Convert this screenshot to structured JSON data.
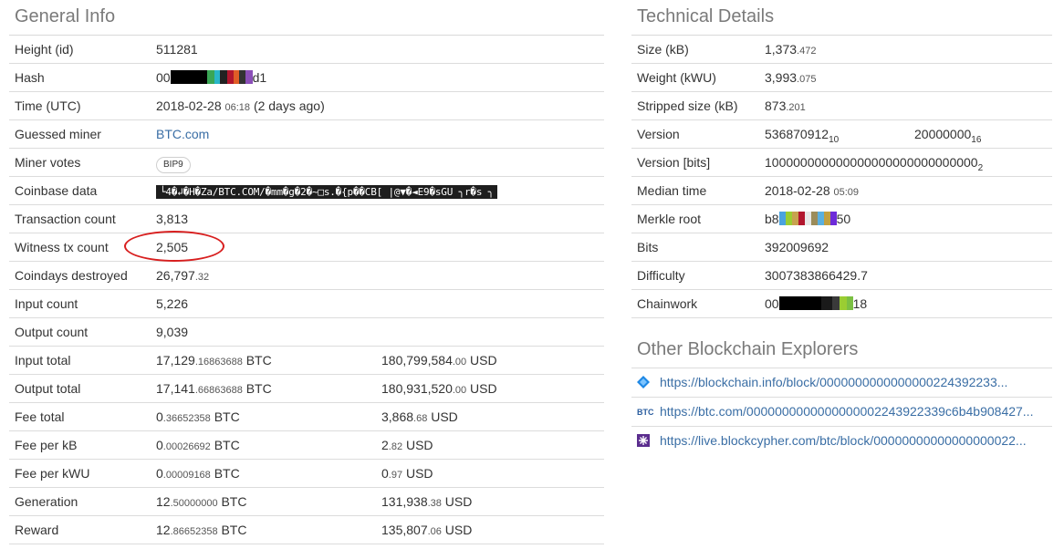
{
  "general": {
    "title": "General Info",
    "height": {
      "label": "Height (id)",
      "value": "511281"
    },
    "hash": {
      "label": "Hash",
      "prefix": "00",
      "suffix": "d1"
    },
    "time": {
      "label": "Time (UTC)",
      "date": "2018-02-28",
      "clock": "06:18",
      "ago": "(2 days ago)"
    },
    "miner": {
      "label": "Guessed miner",
      "value": "BTC.com"
    },
    "votes": {
      "label": "Miner votes",
      "badge": "BIP9"
    },
    "coinbase": {
      "label": "Coinbase data",
      "value": "└4�↲�H�Za/BTC.COM/�mm�g�2�~□s.�{p��CB[ |@▼�◄E9�sGU ╮r�s ╮"
    },
    "tx_count": {
      "label": "Transaction count",
      "value": "3,813"
    },
    "witness": {
      "label": "Witness tx count",
      "value": "2,505"
    },
    "coindays": {
      "label": "Coindays destroyed",
      "main": "26,797",
      "dec": ".32"
    },
    "input_count": {
      "label": "Input count",
      "value": "5,226"
    },
    "output_count": {
      "label": "Output count",
      "value": "9,039"
    },
    "input_total": {
      "label": "Input total",
      "btc_main": "17,129",
      "btc_dec": ".16863688",
      "btc_unit": "BTC",
      "usd_main": "180,799,584",
      "usd_dec": ".00",
      "usd_unit": "USD"
    },
    "output_total": {
      "label": "Output total",
      "btc_main": "17,141",
      "btc_dec": ".66863688",
      "btc_unit": "BTC",
      "usd_main": "180,931,520",
      "usd_dec": ".00",
      "usd_unit": "USD"
    },
    "fee_total": {
      "label": "Fee total",
      "btc_main": "0",
      "btc_dec": ".36652358",
      "btc_unit": "BTC",
      "usd_main": "3,868",
      "usd_dec": ".68",
      "usd_unit": "USD"
    },
    "fee_kb": {
      "label": "Fee per kB",
      "btc_main": "0",
      "btc_dec": ".00026692",
      "btc_unit": "BTC",
      "usd_main": "2",
      "usd_dec": ".82",
      "usd_unit": "USD"
    },
    "fee_kwu": {
      "label": "Fee per kWU",
      "btc_main": "0",
      "btc_dec": ".00009168",
      "btc_unit": "BTC",
      "usd_main": "0",
      "usd_dec": ".97",
      "usd_unit": "USD"
    },
    "generation": {
      "label": "Generation",
      "btc_main": "12",
      "btc_dec": ".50000000",
      "btc_unit": "BTC",
      "usd_main": "131,938",
      "usd_dec": ".38",
      "usd_unit": "USD"
    },
    "reward": {
      "label": "Reward",
      "btc_main": "12",
      "btc_dec": ".86652358",
      "btc_unit": "BTC",
      "usd_main": "135,807",
      "usd_dec": ".06",
      "usd_unit": "USD"
    }
  },
  "technical": {
    "title": "Technical Details",
    "size": {
      "label": "Size (kB)",
      "main": "1,373",
      "dec": ".472"
    },
    "weight": {
      "label": "Weight (kWU)",
      "main": "3,993",
      "dec": ".075"
    },
    "stripped": {
      "label": "Stripped size (kB)",
      "main": "873",
      "dec": ".201"
    },
    "version": {
      "label": "Version",
      "dec_value": "536870912",
      "dec_base": "10",
      "hex_value": "20000000",
      "hex_base": "16"
    },
    "version_bits": {
      "label": "Version [bits]",
      "value": "100000000000000000000000000000",
      "base": "2"
    },
    "median": {
      "label": "Median time",
      "date": "2018-02-28",
      "clock": "05:09"
    },
    "merkle": {
      "label": "Merkle root",
      "prefix": "b8",
      "suffix": "50"
    },
    "bits": {
      "label": "Bits",
      "value": "392009692"
    },
    "difficulty": {
      "label": "Difficulty",
      "value": "3007383866429.7"
    },
    "chainwork": {
      "label": "Chainwork",
      "prefix": "00",
      "suffix": "18"
    }
  },
  "explorers": {
    "title": "Other Blockchain Explorers",
    "items": [
      {
        "icon": "blockchain-info-icon",
        "url": "https://blockchain.info/block/0000000000000000224392233..."
      },
      {
        "icon": "btc-com-icon",
        "url": "https://btc.com/00000000000000000022439223​39c6b4b908427..."
      },
      {
        "icon": "blockcypher-icon",
        "url": "https://live.blockcypher.com/btc/block/00000000000000000022..."
      }
    ]
  },
  "colors": {
    "link": "#3a6ea5",
    "annotation_circle": "#d81f1f",
    "heading": "#7a7a7a",
    "coinbase_bg": "#1e1e1e"
  }
}
